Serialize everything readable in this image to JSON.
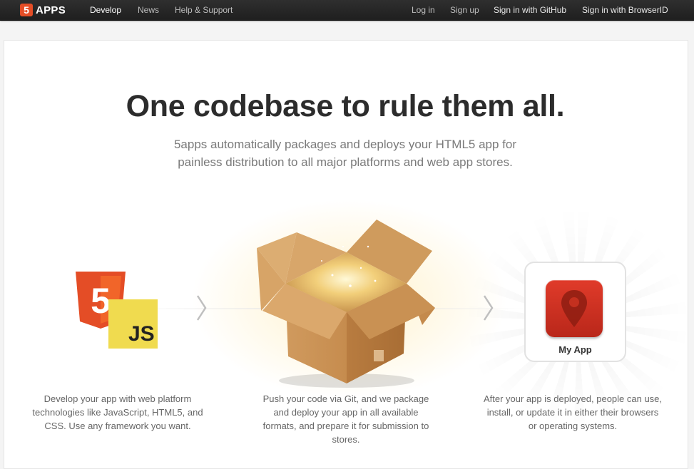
{
  "brand": {
    "mark": "5",
    "name": "APPS"
  },
  "nav": {
    "develop": "Develop",
    "news": "News",
    "help": "Help & Support",
    "login": "Log in",
    "signup": "Sign up",
    "github": "Sign in with GitHub",
    "browserid": "Sign in with BrowserID"
  },
  "hero": {
    "headline": "One codebase to rule them all.",
    "sub_lines": [
      "5apps automatically packages and deploys your HTML5 app for",
      "painless distribution to all major platforms and web app stores."
    ]
  },
  "icons": {
    "html5_mark": "5",
    "js_label": "JS",
    "app_label": "My App"
  },
  "steps": [
    {
      "lines": [
        "Develop your app with web platform",
        "technologies like JavaScript, HTML5, and",
        "CSS. Use any framework you want."
      ]
    },
    {
      "lines": [
        "Push your code via Git, and we package",
        "and deploy your app in all available",
        "formats, and prepare it for submission to",
        "stores."
      ]
    },
    {
      "lines": [
        "After your app is deployed, people can use,",
        "install, or update it in either their browsers",
        "or operating systems."
      ]
    }
  ],
  "colors": {
    "brand_orange": "#e44d26",
    "js_yellow": "#f0db4f",
    "app_red": "#d63526",
    "topbar": "#262626"
  }
}
